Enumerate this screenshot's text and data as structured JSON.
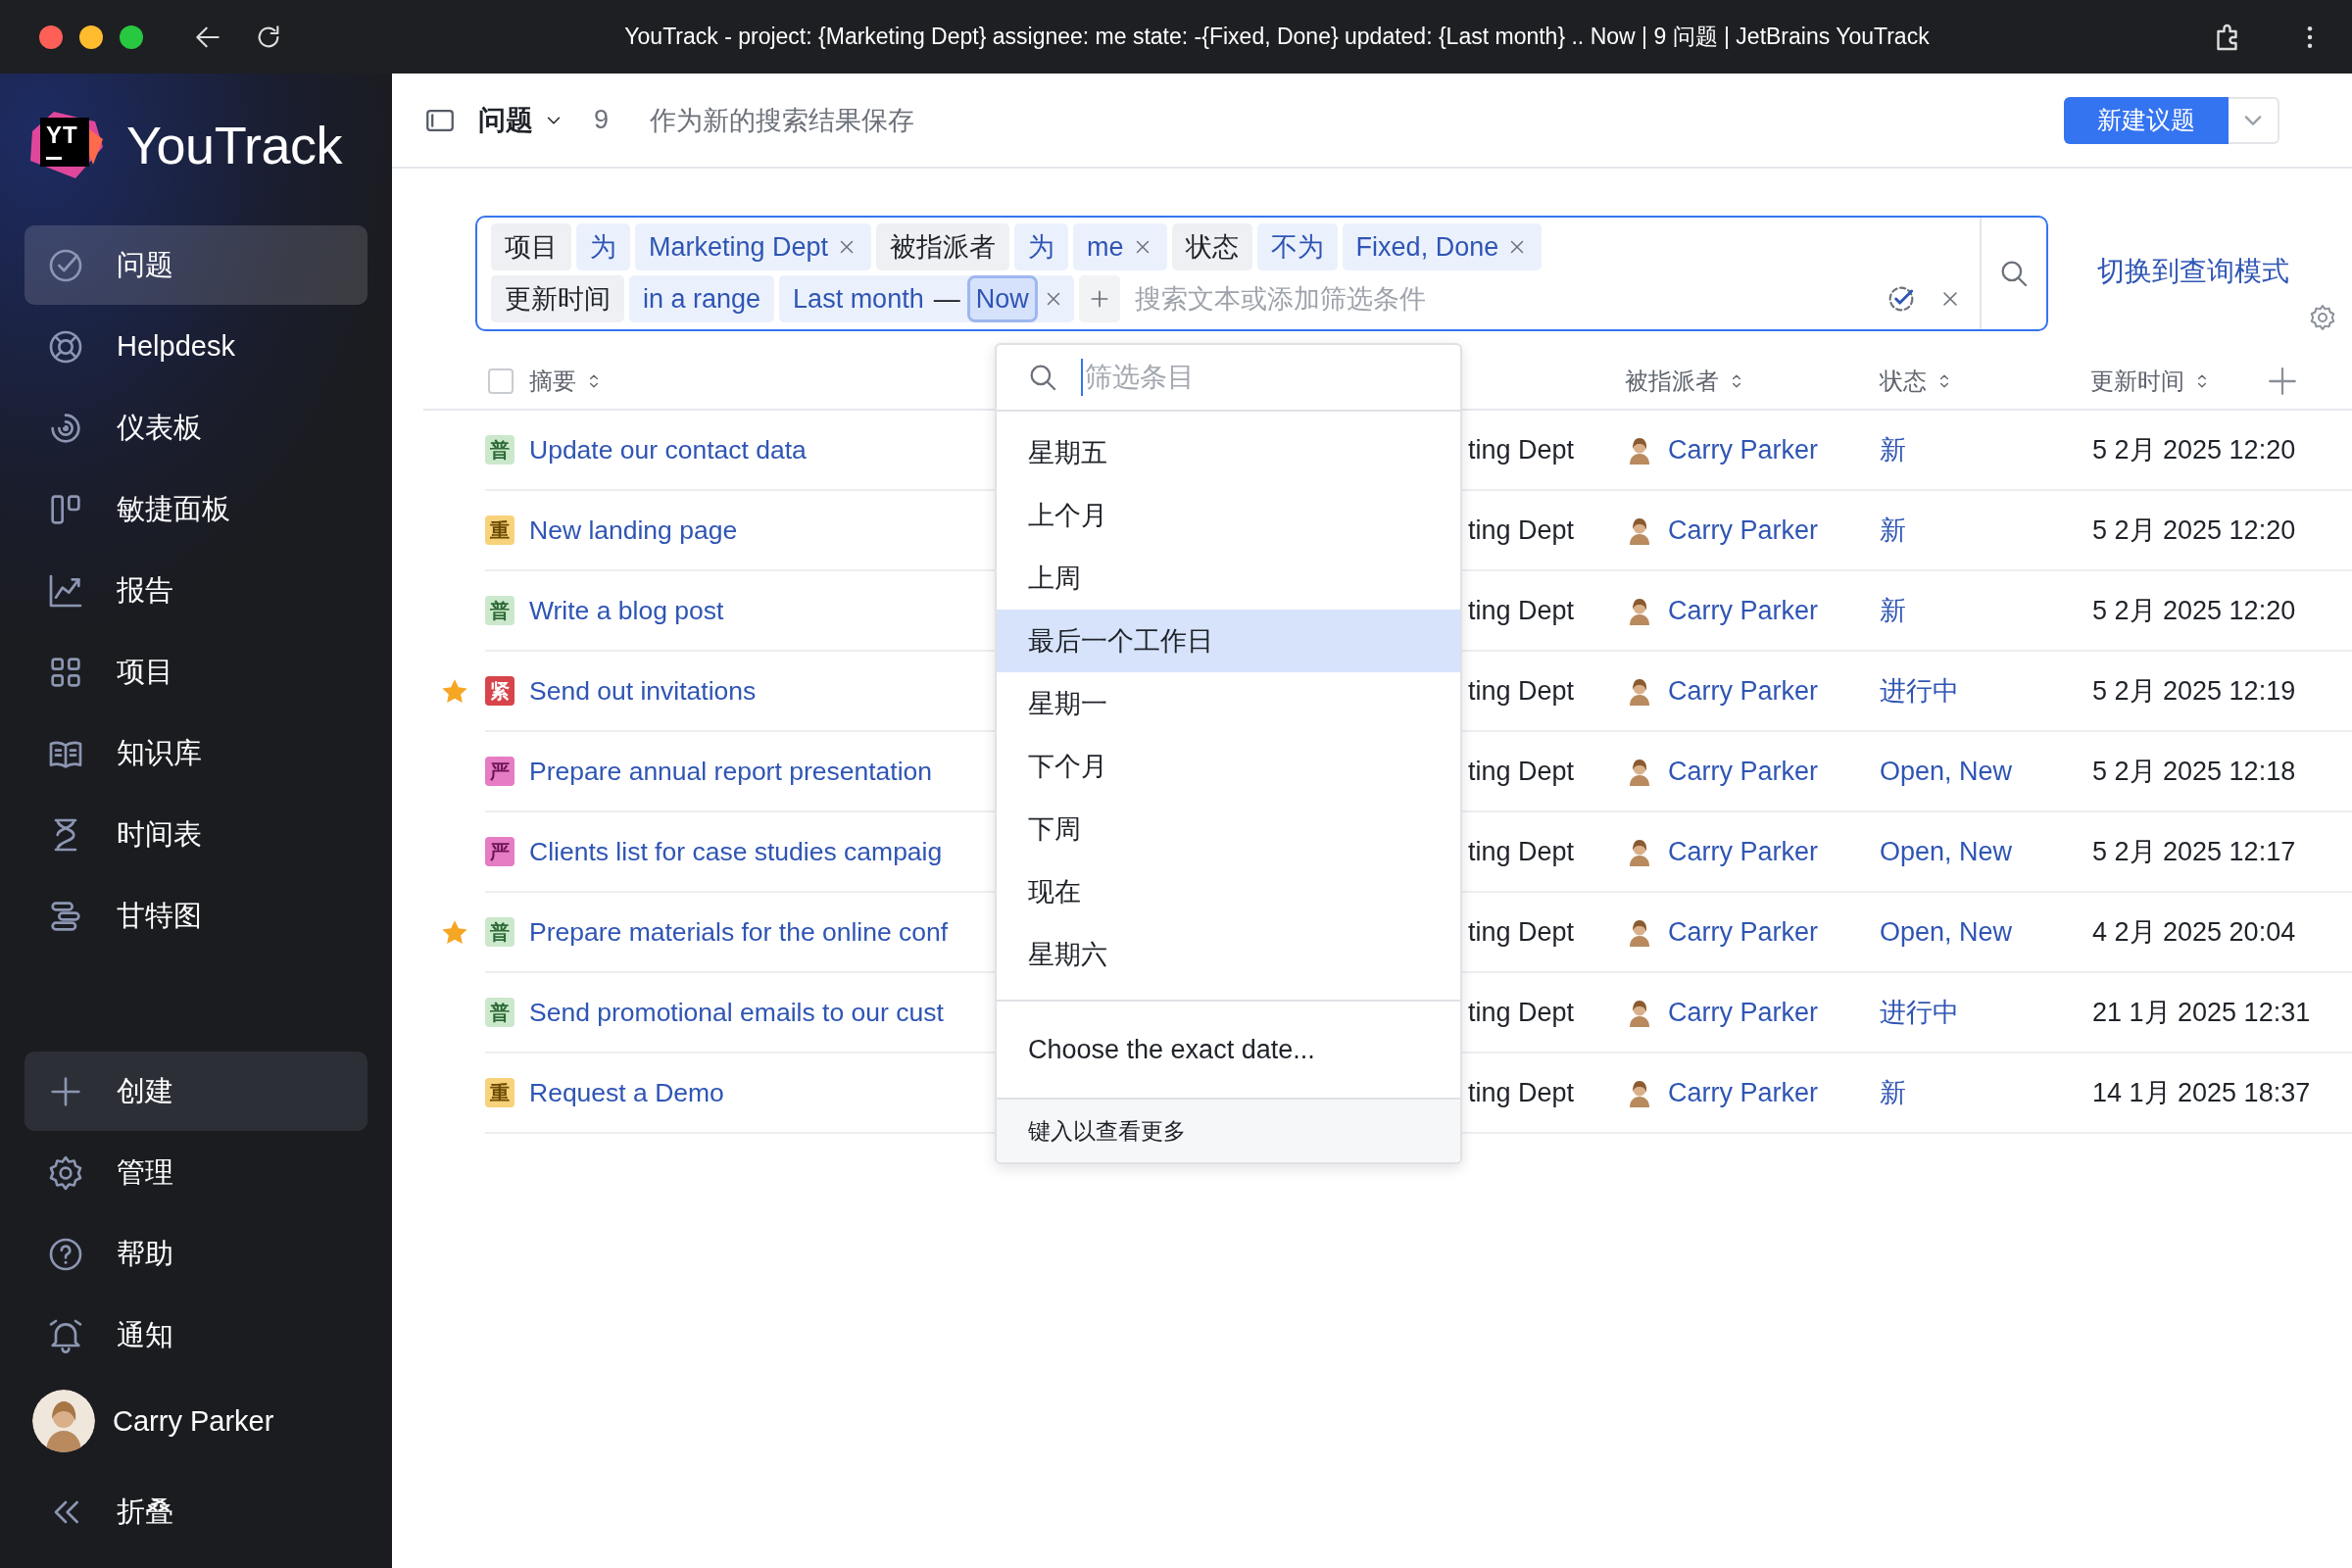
{
  "window": {
    "title": "YouTrack - project: {Marketing Dept} assignee: me state: -{Fixed, Done} updated: {Last month} .. Now | 9 问题 | JetBrains YouTrack"
  },
  "sidebar": {
    "logo_mark": "YT",
    "logo_text": "YouTrack",
    "items": [
      {
        "label": "问题",
        "selected": true
      },
      {
        "label": "Helpdesk",
        "selected": false
      },
      {
        "label": "仪表板",
        "selected": false
      },
      {
        "label": "敏捷面板",
        "selected": false
      },
      {
        "label": "报告",
        "selected": false
      },
      {
        "label": "项目",
        "selected": false
      },
      {
        "label": "知识库",
        "selected": false
      },
      {
        "label": "时间表",
        "selected": false
      },
      {
        "label": "甘特图",
        "selected": false
      }
    ],
    "create_button": "创建",
    "footer_items": [
      "管理",
      "帮助",
      "通知"
    ],
    "user": {
      "name": "Carry Parker"
    },
    "collapse": "折叠"
  },
  "header": {
    "title": "问题",
    "count": "9",
    "save_link": "作为新的搜索结果保存",
    "new_button": "新建议题"
  },
  "query": {
    "lines": [
      {
        "chips": [
          {
            "kind": "field",
            "text": "项目",
            "removable": false
          },
          {
            "kind": "operator",
            "text": "为",
            "removable": false
          },
          {
            "kind": "value",
            "text": "Marketing Dept",
            "removable": true
          },
          {
            "kind": "field",
            "text": "被指派者",
            "removable": false
          },
          {
            "kind": "operator",
            "text": "为",
            "removable": false
          },
          {
            "kind": "value",
            "text": "me",
            "removable": true
          },
          {
            "kind": "field",
            "text": "状态",
            "removable": false
          },
          {
            "kind": "operator",
            "text": "不为",
            "removable": false
          },
          {
            "kind": "value",
            "text": "Fixed, Done",
            "removable": true
          }
        ]
      },
      {
        "chips": [
          {
            "kind": "field",
            "text": "更新时间",
            "removable": false
          },
          {
            "kind": "operator",
            "text": "in a range",
            "removable": false
          },
          {
            "kind": "range",
            "from": "Last month",
            "separator": "—",
            "to": "Now",
            "to_focused": true,
            "removable": true
          }
        ]
      }
    ],
    "placeholder": "搜索文本或添加筛选条件",
    "switch_link": "切换到查询模式"
  },
  "table": {
    "select_all_checked": false,
    "columns": [
      {
        "label": "摘要"
      },
      {
        "label": "被指派者"
      },
      {
        "label": "状态"
      },
      {
        "label": "更新时间"
      }
    ],
    "rows": [
      {
        "starred": false,
        "priority": "普",
        "color": "#cbe8cc",
        "summary": "Update our contact data",
        "project": "ting Dept",
        "assignee": "Carry Parker",
        "state": "新",
        "updated": "5 2月 2025 12:20"
      },
      {
        "starred": false,
        "priority": "重",
        "color": "#f8d27a",
        "summary": "New landing page",
        "project": "ting Dept",
        "assignee": "Carry Parker",
        "state": "新",
        "updated": "5 2月 2025 12:20"
      },
      {
        "starred": false,
        "priority": "普",
        "color": "#cbe8cc",
        "summary": "Write a blog post",
        "project": "ting Dept",
        "assignee": "Carry Parker",
        "state": "新",
        "updated": "5 2月 2025 12:20"
      },
      {
        "starred": true,
        "priority": "紧",
        "color": "#d8444b",
        "summary": "Send out invitations",
        "project": "ting Dept",
        "assignee": "Carry Parker",
        "state": "进行中",
        "updated": "5 2月 2025 12:19"
      },
      {
        "starred": false,
        "priority": "严",
        "color": "#e57cc4",
        "summary": "Prepare annual report presentation",
        "project": "ting Dept",
        "assignee": "Carry Parker",
        "state": "Open, New",
        "updated": "5 2月 2025 12:18"
      },
      {
        "starred": false,
        "priority": "严",
        "color": "#e57cc4",
        "summary": "Clients list for case studies campaig",
        "project": "ting Dept",
        "assignee": "Carry Parker",
        "state": "Open, New",
        "updated": "5 2月 2025 12:17"
      },
      {
        "starred": true,
        "priority": "普",
        "color": "#cbe8cc",
        "summary": "Prepare materials for the online conf",
        "project": "ting Dept",
        "assignee": "Carry Parker",
        "state": "Open, New",
        "updated": "4 2月 2025 20:04"
      },
      {
        "starred": false,
        "priority": "普",
        "color": "#cbe8cc",
        "summary": "Send promotional emails to our cust",
        "project": "ting Dept",
        "assignee": "Carry Parker",
        "state": "进行中",
        "updated": "21 1月 2025 12:31"
      },
      {
        "starred": false,
        "priority": "重",
        "color": "#f8d27a",
        "summary": "Request a Demo",
        "project": "ting Dept",
        "assignee": "Carry Parker",
        "state": "新",
        "updated": "14 1月 2025 18:37"
      }
    ]
  },
  "dropdown": {
    "placeholder": "筛选条目",
    "items": [
      {
        "label": "星期五",
        "selected": false
      },
      {
        "label": "上个月",
        "selected": false
      },
      {
        "label": "上周",
        "selected": false
      },
      {
        "label": "最后一个工作日",
        "selected": true
      },
      {
        "label": "星期一",
        "selected": false
      },
      {
        "label": "下个月",
        "selected": false
      },
      {
        "label": "下周",
        "selected": false
      },
      {
        "label": "现在",
        "selected": false
      },
      {
        "label": "星期六",
        "selected": false
      }
    ],
    "exact_date": "Choose the exact date...",
    "footer": "键入以查看更多"
  }
}
